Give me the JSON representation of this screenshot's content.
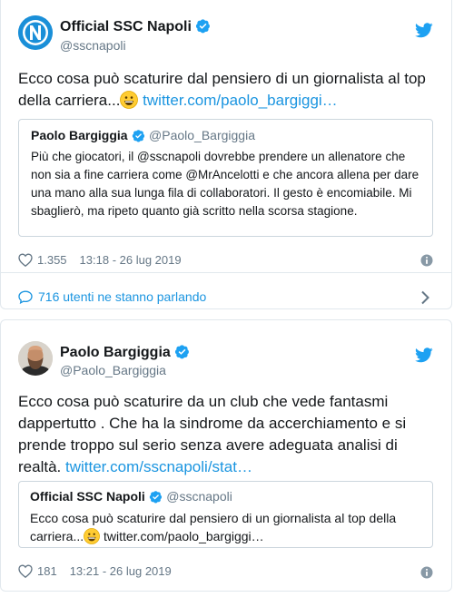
{
  "tweet1": {
    "author_name": "Official SSC Napoli",
    "author_handle": "@sscnapoli",
    "text": "Ecco cosa può scaturire dal pensiero di un giornalista al top della carriera...",
    "link": "twitter.com/paolo_bargiggi…",
    "quote": {
      "author_name": "Paolo Bargiggia",
      "author_handle": "@Paolo_Bargiggia",
      "text": "Più che giocatori, il @sscnapoli dovrebbe prendere un allenatore che non sia a fine carriera come @MrAncelotti e che ancora allena per dare una mano alla sua lunga fila di collaboratori. Il gesto è encomiabile. Mi sbaglierò, ma ripeto quanto già scritto nella scorsa stagione."
    },
    "likes": "1.355",
    "timestamp": "13:18 - 26 lug 2019",
    "talking": "716 utenti ne stanno parlando"
  },
  "tweet2": {
    "author_name": "Paolo Bargiggia",
    "author_handle": "@Paolo_Bargiggia",
    "text": "Ecco cosa può scaturire da un club che vede fantasmi dappertutto . Che ha la sindrome da accerchiamento e si prende troppo sul serio senza avere adeguata analisi di realtà.",
    "link": "twitter.com/sscnapoli/stat…",
    "quote": {
      "author_name": "Official SSC Napoli",
      "author_handle": "@sscnapoli",
      "text": "Ecco cosa può scaturire dal pensiero di un giornalista al top della carriera...",
      "link": "twitter.com/paolo_bargiggi…"
    },
    "likes": "181",
    "timestamp": "13:21 - 26 lug 2019"
  },
  "colors": {
    "link": "#1b95e0",
    "verified": "#1da1f2",
    "secondary_text": "#657786",
    "border": "#e1e8ed",
    "napoli_blue": "#1a8fd8"
  },
  "icons": [
    "napoli-logo",
    "verified-icon",
    "twitter-bird-icon",
    "heart-icon",
    "info-icon",
    "chat-bubble-icon",
    "chevron-right-icon",
    "grinning-emoji"
  ]
}
